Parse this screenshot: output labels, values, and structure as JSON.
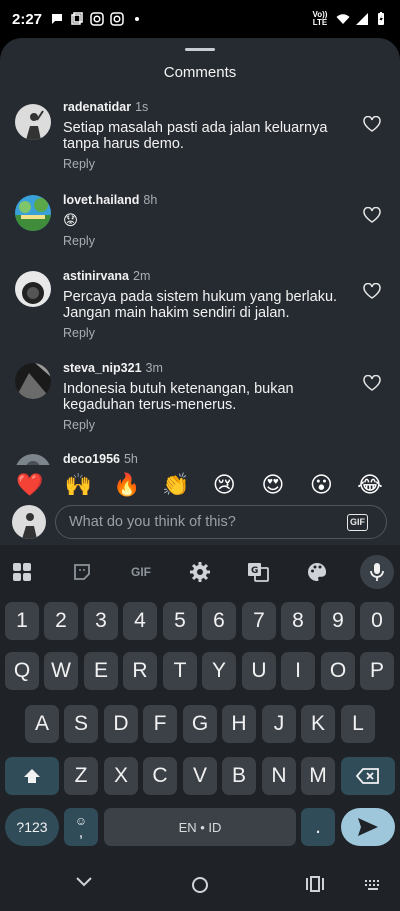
{
  "status": {
    "time": "2:27",
    "network": "Vo)) LTE"
  },
  "sheet": {
    "title": "Comments"
  },
  "comments": [
    {
      "user": "radenatidar",
      "time": "1s",
      "text": "Setiap masalah pasti ada jalan keluarnya tanpa harus demo.",
      "reply": "Reply"
    },
    {
      "user": "lovet.hailand",
      "time": "8h",
      "text": "😟",
      "reply": "Reply"
    },
    {
      "user": "astinirvana",
      "time": "2m",
      "text": "Percaya pada sistem hukum yang berlaku. Jangan main hakim sendiri di jalan.",
      "reply": "Reply"
    },
    {
      "user": "steva_nip321",
      "time": "3m",
      "text": "Indonesia butuh ketenangan, bukan kegaduhan terus-menerus.",
      "reply": "Reply"
    },
    {
      "user": "deco1956",
      "time": "5h"
    }
  ],
  "emoji_bar": [
    "❤️",
    "🙌",
    "🔥",
    "👏",
    "😢",
    "😍",
    "😮",
    "😂"
  ],
  "input": {
    "placeholder": "What do you think of this?",
    "gif_label": "GIF"
  },
  "keyboard": {
    "toolbar_gif": "GIF",
    "number_row": [
      "1",
      "2",
      "3",
      "4",
      "5",
      "6",
      "7",
      "8",
      "9",
      "0"
    ],
    "row1": [
      "Q",
      "W",
      "E",
      "R",
      "T",
      "Y",
      "U",
      "I",
      "O",
      "P"
    ],
    "row2": [
      "A",
      "S",
      "D",
      "F",
      "G",
      "H",
      "J",
      "K",
      "L"
    ],
    "row3": [
      "Z",
      "X",
      "C",
      "V",
      "B",
      "N",
      "M"
    ],
    "symbols_label": "?123",
    "comma_label": ",",
    "space_label": "EN • ID",
    "period_label": "."
  },
  "colors": {
    "sheet_bg": "#262b31",
    "keyboard_bg": "#1f2327",
    "key_bg": "#3c4147",
    "accent_key": "#2f4c58",
    "enter_key": "#9ec7dc"
  }
}
